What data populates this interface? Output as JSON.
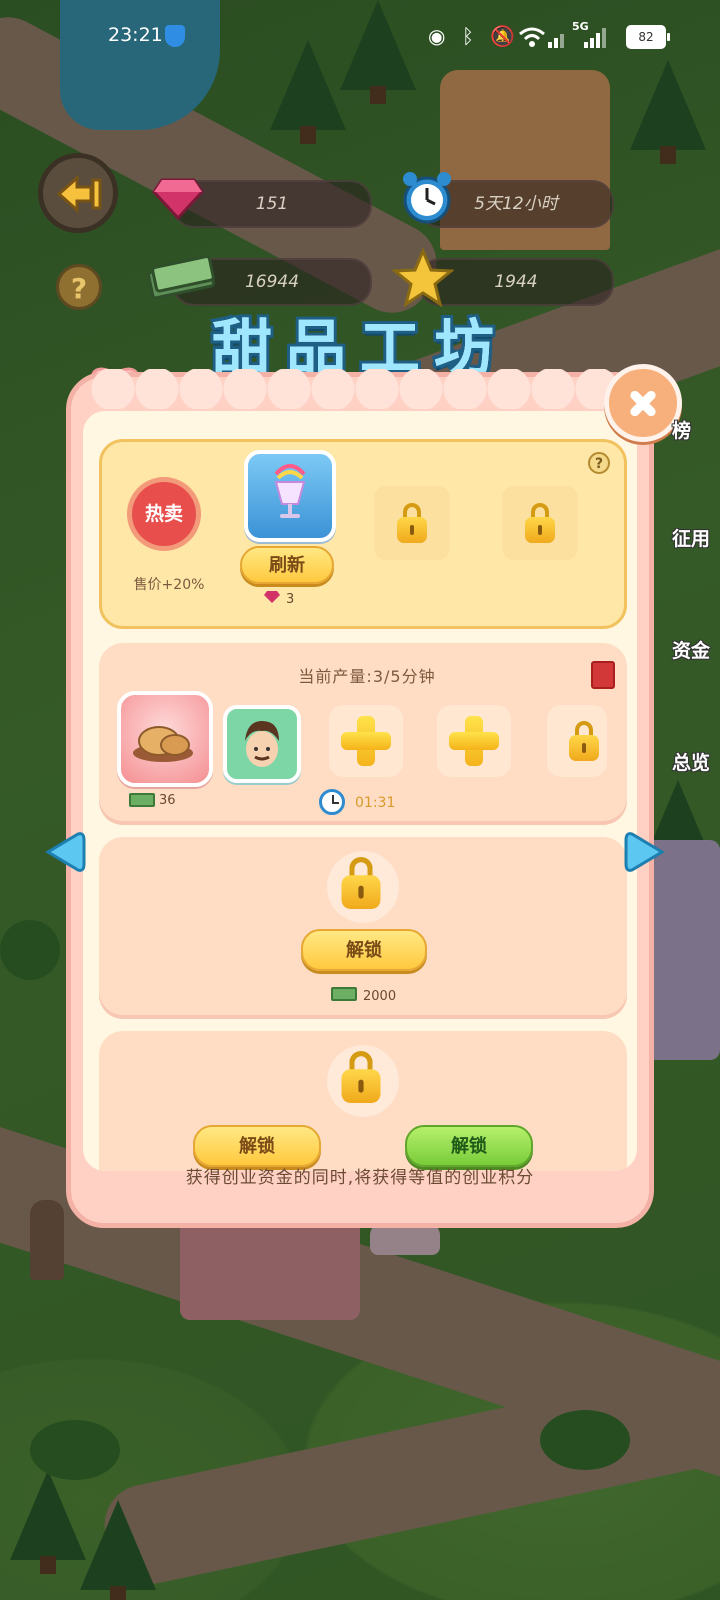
{
  "status_bar": {
    "time": "23:21",
    "network_label": "5G",
    "battery_level": "82"
  },
  "resources": {
    "gems": "151",
    "timer": "5天12小时",
    "cash": "16944",
    "stars": "1944"
  },
  "title": "甜品工坊",
  "hot_sale": {
    "badge": "热卖",
    "bonus_label": "售价+20%",
    "refresh_button": "刷新",
    "refresh_cost": "3"
  },
  "production": {
    "heading": "当前产量:3/5分钟",
    "product_earn": "36",
    "timer": "01:31"
  },
  "unlock_slot_1": {
    "button": "解锁",
    "cost": "2000"
  },
  "unlock_slot_2": {
    "button_left": "解锁",
    "button_right": "解锁"
  },
  "bottom_note": "获得创业资金的同时,将获得等值的创业积分",
  "side_menu": [
    "榜",
    "征用",
    "资金",
    "总览"
  ],
  "colors": {
    "panel_pink": "#ffd1c5",
    "card_yellow": "#ffe7a8",
    "button_yellow": "#ffc93e",
    "button_green": "#79cc3a",
    "title_blue": "#9fe7ff"
  },
  "icons": [
    "back-icon",
    "help-icon",
    "gem-icon",
    "alarm-clock-icon",
    "cash-icon",
    "star-icon",
    "close-icon",
    "lock-icon",
    "plus-icon",
    "recipe-book-icon",
    "left-arrow-icon",
    "right-arrow-icon"
  ]
}
